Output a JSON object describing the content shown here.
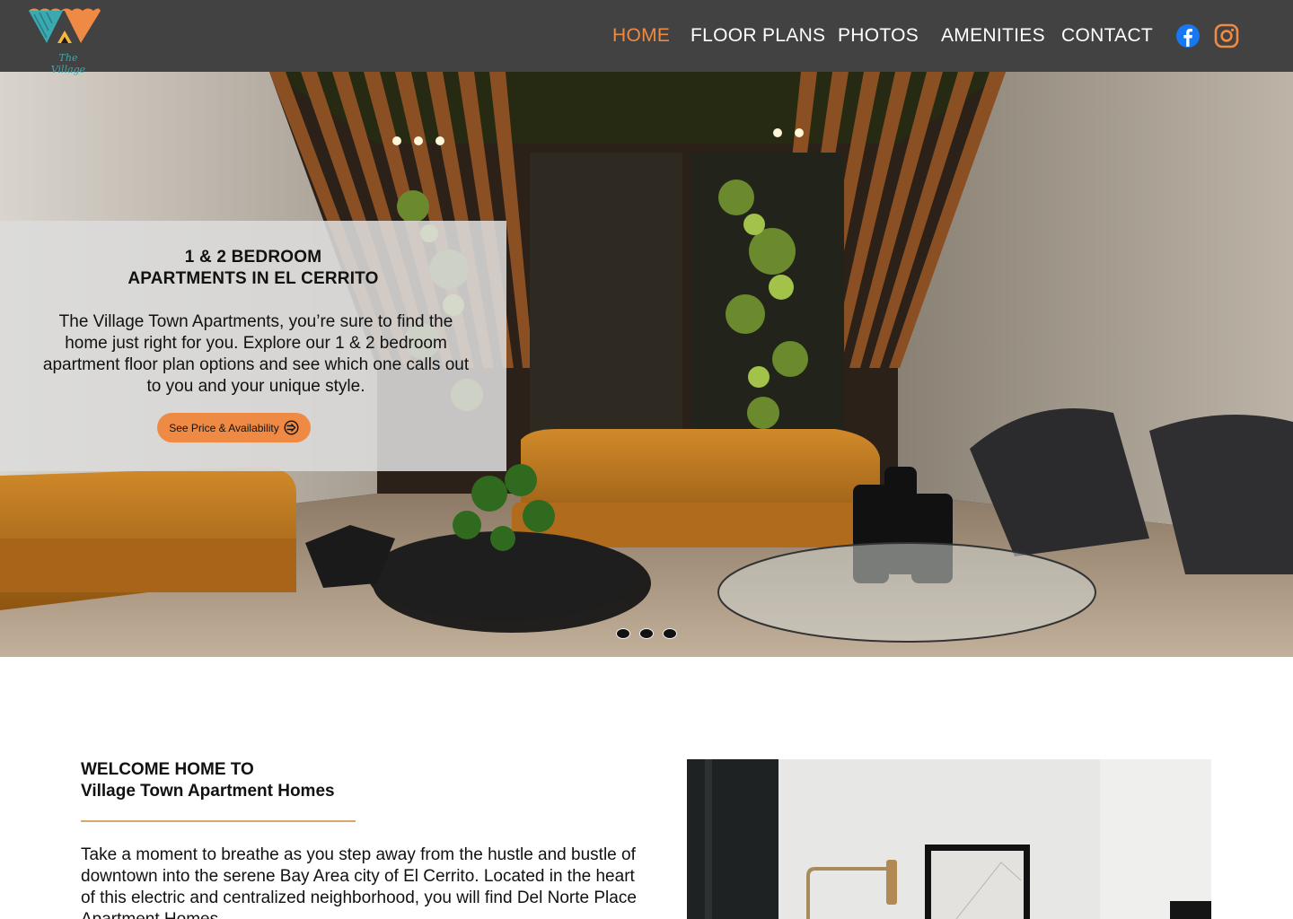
{
  "brand": {
    "logo_text": "The Village",
    "colors": {
      "teal": "#3aa9b0",
      "coral": "#ef8a45",
      "yellow": "#f6b73c"
    }
  },
  "nav": {
    "items": [
      {
        "label": "HOME",
        "active": true
      },
      {
        "label": "FLOOR PLANS",
        "active": false
      },
      {
        "label": "PHOTOS",
        "active": false
      },
      {
        "label": "AMENITIES",
        "active": false
      },
      {
        "label": "CONTACT",
        "active": false
      }
    ],
    "social": [
      {
        "icon": "facebook-icon",
        "color": "#1877f2"
      },
      {
        "icon": "instagram-icon",
        "color": "#ef8a45"
      }
    ]
  },
  "hero": {
    "title_line1": "1 & 2 BEDROOM",
    "title_line2": "APARTMENTS IN EL CERRITO",
    "description": "The Village Town Apartments, you’re sure to find the home just right for you. Explore our 1 & 2 bedroom apartment floor plan options and see which one calls out to you and your unique style.",
    "button_label": "See Price & Availability",
    "slide_count": 3
  },
  "welcome": {
    "title_line1": "WELCOME HOME TO",
    "title_line2": "Village Town Apartment Homes",
    "body": "Take a moment to breathe as you step away from the hustle and bustle of downtown into the serene Bay Area city of El Cerrito. Located in the heart of this electric and centralized neighborhood, you will find Del Norte Place Apartment Homes."
  },
  "colors": {
    "header_bg": "#424242",
    "accent": "#ef8a45",
    "divider": "#d9a56a"
  }
}
